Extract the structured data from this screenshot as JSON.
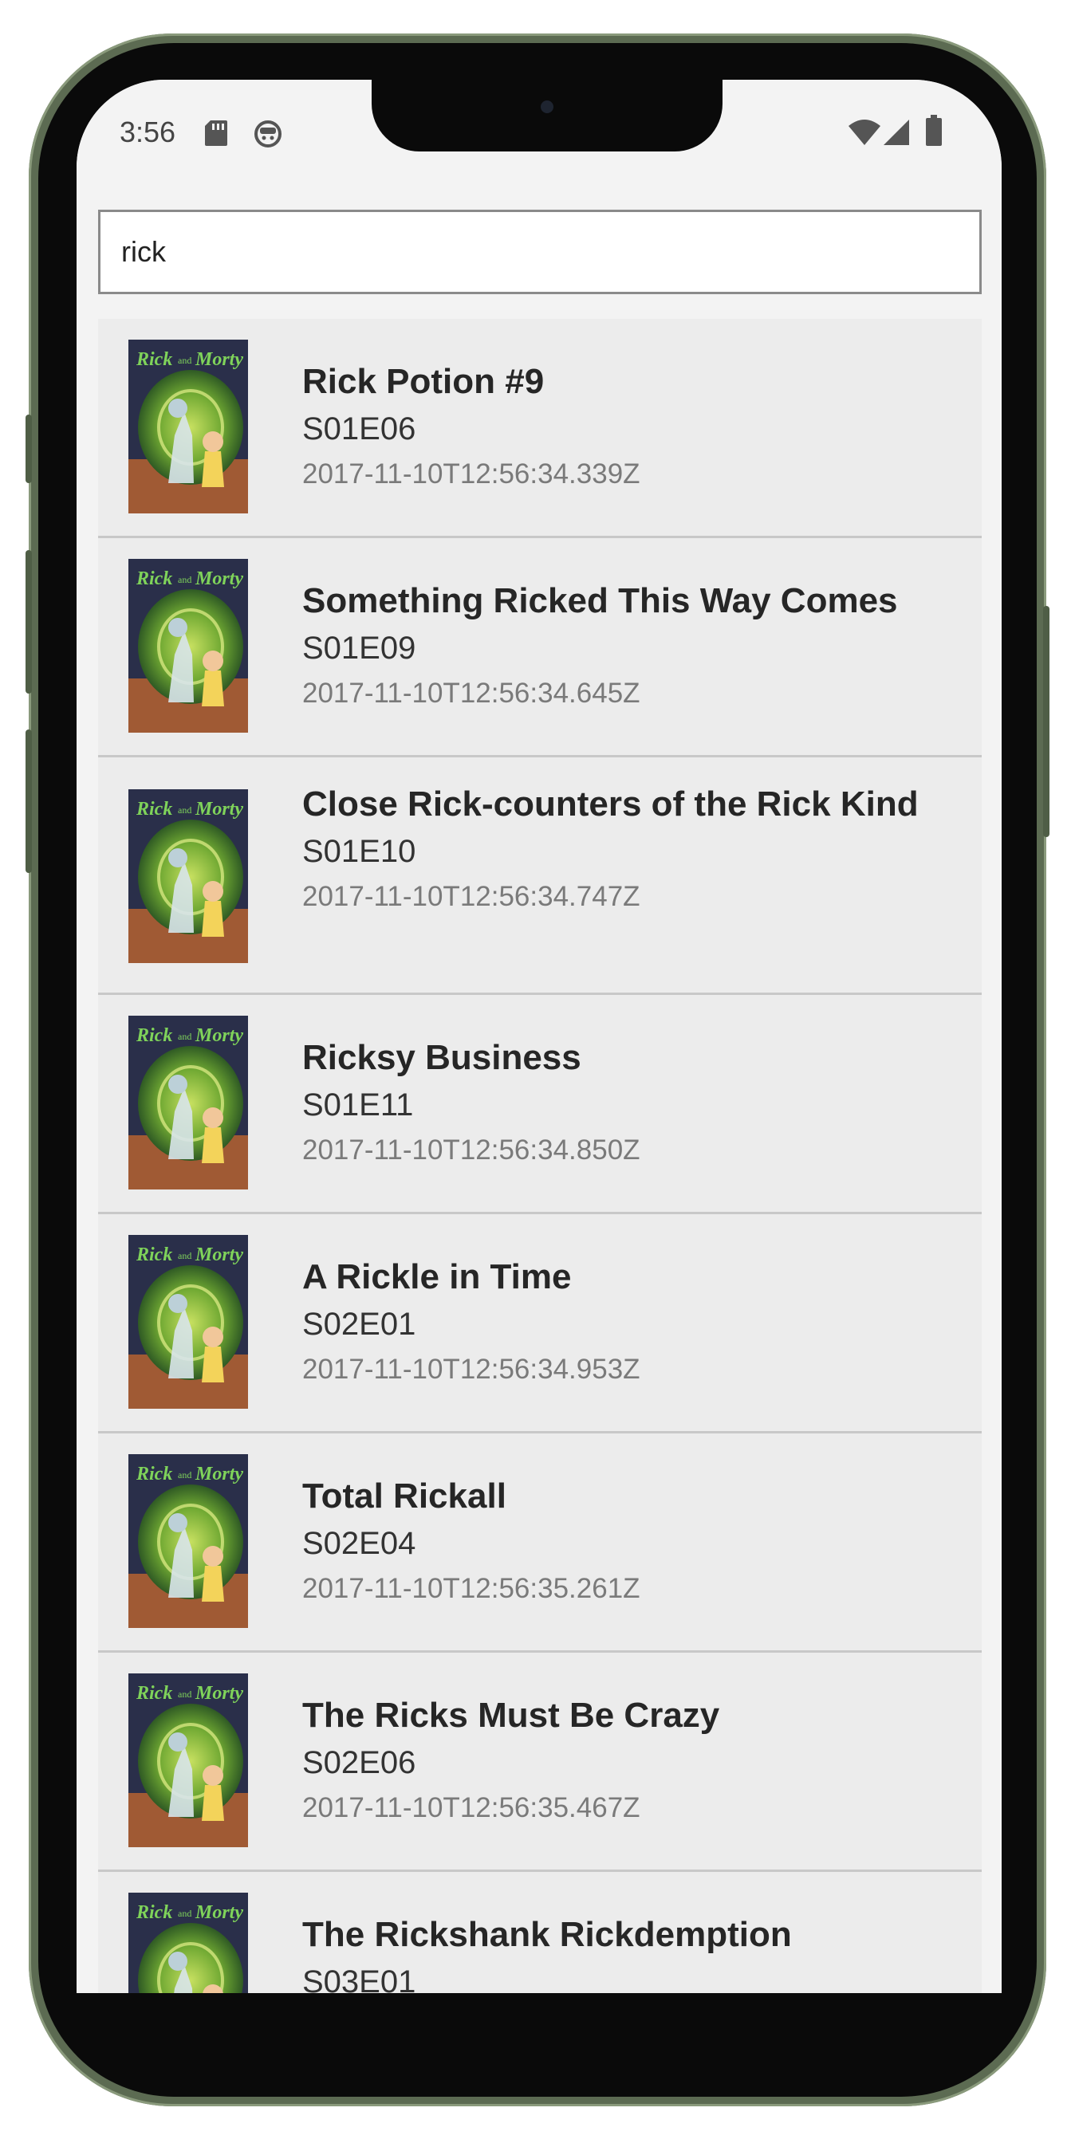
{
  "status_bar": {
    "time": "3:56",
    "left_icons": [
      "sd-card-icon",
      "app-notification-icon"
    ],
    "right_icons": [
      "wifi-icon",
      "cell-signal-icon",
      "battery-icon"
    ]
  },
  "search": {
    "value": "rick"
  },
  "episodes": [
    {
      "title": "Rick Potion #9",
      "code": "S01E06",
      "date": "2017-11-10T12:56:34.339Z"
    },
    {
      "title": "Something Ricked This Way Comes",
      "code": "S01E09",
      "date": "2017-11-10T12:56:34.645Z"
    },
    {
      "title": "Close Rick-counters of the Rick Kind",
      "code": "S01E10",
      "date": "2017-11-10T12:56:34.747Z"
    },
    {
      "title": "Ricksy Business",
      "code": "S01E11",
      "date": "2017-11-10T12:56:34.850Z"
    },
    {
      "title": "A Rickle in Time",
      "code": "S02E01",
      "date": "2017-11-10T12:56:34.953Z"
    },
    {
      "title": "Total Rickall",
      "code": "S02E04",
      "date": "2017-11-10T12:56:35.261Z"
    },
    {
      "title": "The Ricks Must Be Crazy",
      "code": "S02E06",
      "date": "2017-11-10T12:56:35.467Z"
    },
    {
      "title": "The Rickshank Rickdemption",
      "code": "S03E01",
      "date": ""
    }
  ],
  "thumbnail_logo": "Rick and Morty",
  "colors": {
    "frame": "#5c6b52",
    "item_background": "#ececec",
    "divider": "#c8c8c8",
    "title_text": "#262626",
    "date_text": "#7a7a7a"
  }
}
